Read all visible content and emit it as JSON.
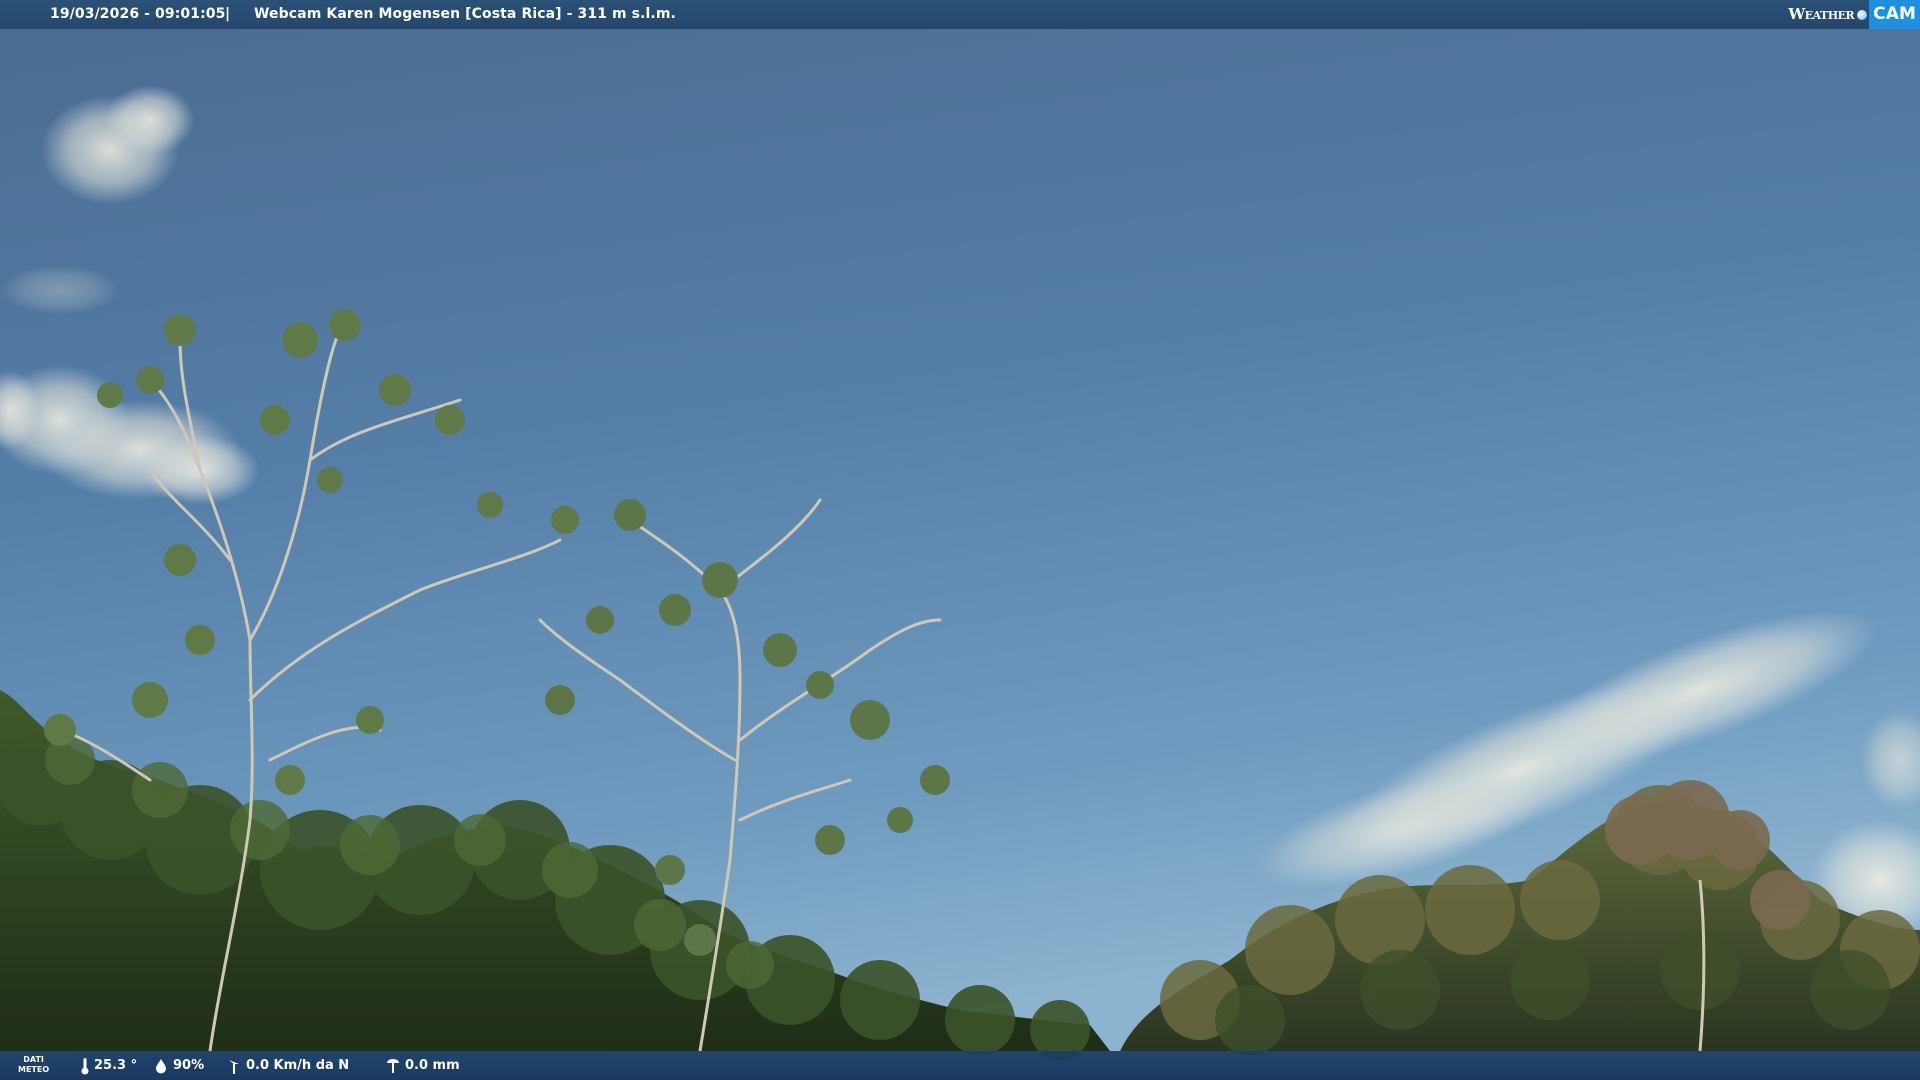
{
  "header": {
    "datetime": "19/03/2026 - 09:01:05",
    "separator": "|",
    "title": "Webcam Karen Mogensen [Costa Rica] - 311 m s.l.m."
  },
  "logo": {
    "weather_text": "Weather",
    "cam_text": "CAM"
  },
  "weather_bar": {
    "label_line1": "DATI",
    "label_line2": "METEO",
    "temperature": "25.3 °",
    "humidity": "90%",
    "wind": "0.0 Km/h da N",
    "rain": "0.0 mm",
    "icons": [
      "thermometer-icon",
      "humidity-drop-icon",
      "wind-vane-icon",
      "rain-gauge-icon"
    ]
  },
  "scene": {
    "description_colors": {
      "sky_top": "#3d5f86",
      "sky_bottom": "#7ea7c8",
      "foliage": "#2e3f1f",
      "bar": "#24476c"
    }
  }
}
